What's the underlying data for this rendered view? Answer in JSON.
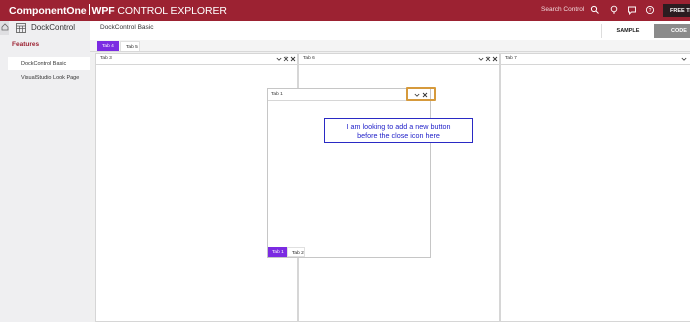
{
  "topbar": {
    "brand_strong": "ComponentOne",
    "brand_product": "WPF",
    "brand_rest": "CONTROL EXPLORER",
    "search_label": "Search Control",
    "free_trial": "FREE TRIAL",
    "icons": [
      "search-icon",
      "lightbulb-icon",
      "chat-icon",
      "help-icon",
      "account-icon"
    ],
    "color": "#9c2232"
  },
  "sidebar": {
    "control_name": "DockControl",
    "features_heading": "Features",
    "items": [
      {
        "label": "DockControl Basic",
        "active": true
      },
      {
        "label": "VisualStudio Look Page",
        "active": false
      }
    ]
  },
  "header": {
    "breadcrumb": "DockControl Basic",
    "sample_label": "SAMPLE",
    "code_label": "CODE"
  },
  "dock": {
    "top_tabs": [
      {
        "label": "Tab 4",
        "selected": true
      },
      {
        "label": "Tab 5",
        "selected": false
      }
    ],
    "panes": [
      {
        "title": "Tab 3"
      },
      {
        "title": "Tab 6"
      },
      {
        "title": "Tab 7"
      }
    ],
    "floating": {
      "title": "Tab 1",
      "bottom_tabs": [
        {
          "label": "Tab 1",
          "selected": true
        },
        {
          "label": "Tab 2",
          "selected": false
        }
      ]
    },
    "accent_color": "#7b2be2"
  },
  "annotation": {
    "line1": "I am looking to add a new button",
    "line2": "before the close icon here",
    "highlight_color": "#d69a3c"
  }
}
